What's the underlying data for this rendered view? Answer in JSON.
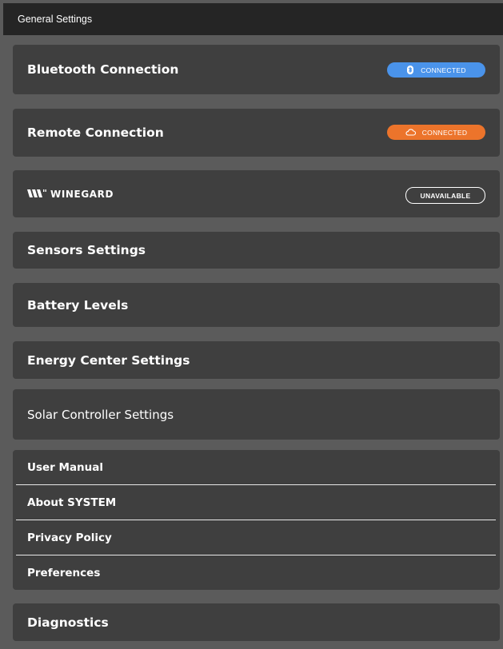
{
  "header": {
    "title": "General Settings"
  },
  "cards": {
    "bluetooth": {
      "label": "Bluetooth Connection",
      "status": "CONNECTED"
    },
    "remote": {
      "label": "Remote Connection",
      "status": "CONNECTED"
    },
    "winegard": {
      "brand": "WINEGARD",
      "status": "UNAVAILABLE"
    },
    "sensors": {
      "label": "Sensors Settings"
    },
    "battery": {
      "label": "Battery Levels"
    },
    "energy": {
      "label": "Energy Center Settings"
    },
    "solar": {
      "label": "Solar Controller Settings"
    },
    "diagnostics": {
      "label": "Diagnostics"
    }
  },
  "menu": {
    "items": [
      {
        "label": "User Manual"
      },
      {
        "label": "About SYSTEM"
      },
      {
        "label": "Privacy Policy"
      },
      {
        "label": "Preferences"
      }
    ]
  },
  "colors": {
    "background": "#5b5b5b",
    "card": "#3f3f3f",
    "topbar": "#252525",
    "bluetooth_pill": "#4a93ea",
    "remote_pill": "#ec742b"
  },
  "icons": {
    "bluetooth": "bluetooth-icon",
    "cloud": "cloud-icon",
    "winegard_logo": "winegard-logo-icon"
  }
}
